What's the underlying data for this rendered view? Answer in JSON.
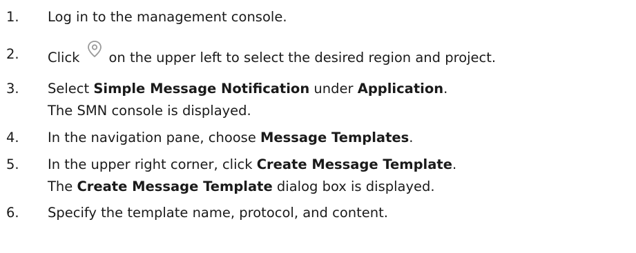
{
  "steps": [
    {
      "number": "1.",
      "text": "Log in to the management console."
    },
    {
      "number": "2.",
      "text_before": "Click",
      "icon": "location-pin-icon",
      "text_after": "on the upper left to select the desired region and project."
    },
    {
      "number": "3.",
      "pre": "Select ",
      "bold1": "Simple Message Notification",
      "mid": " under ",
      "bold2": "Application",
      "post": ".",
      "note": "The SMN console is displayed."
    },
    {
      "number": "4.",
      "pre": "In the navigation pane, choose ",
      "bold": "Message Templates",
      "post": "."
    },
    {
      "number": "5.",
      "pre": "In the upper right corner, click ",
      "bold": "Create Message Template",
      "post": ".",
      "note_pre": "The ",
      "note_bold": "Create Message Template",
      "note_post": " dialog box is displayed."
    },
    {
      "number": "6.",
      "text": "Specify the template name, protocol, and content."
    }
  ],
  "colors": {
    "text": "#1a1a1a",
    "icon": "#9a9a9a"
  }
}
